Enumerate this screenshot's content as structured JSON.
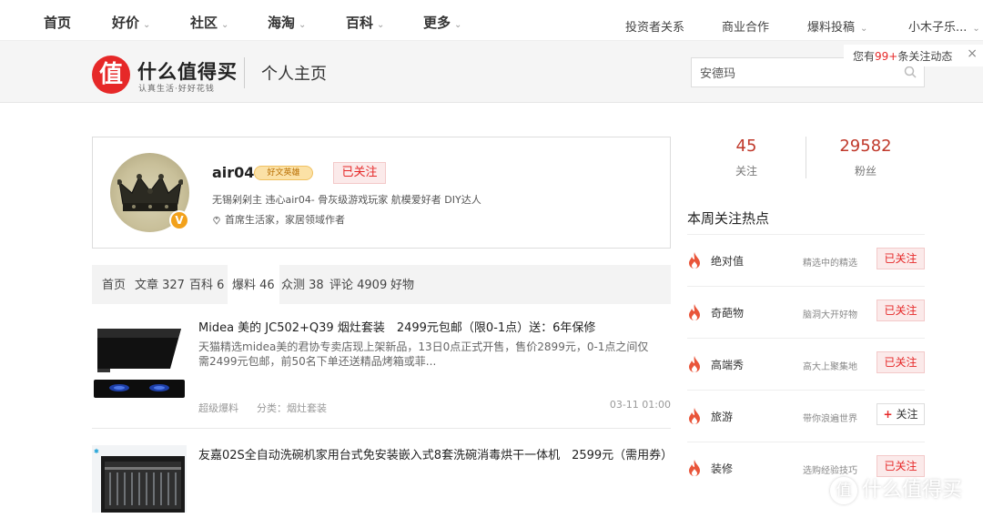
{
  "topnav": {
    "left": [
      {
        "label": "首页",
        "chevron": false
      },
      {
        "label": "好价",
        "chevron": true
      },
      {
        "label": "社区",
        "chevron": true
      },
      {
        "label": "海淘",
        "chevron": true
      },
      {
        "label": "百科",
        "chevron": true
      },
      {
        "label": "更多",
        "chevron": true
      }
    ],
    "right": [
      {
        "label": "投资者关系",
        "chevron": false
      },
      {
        "label": "商业合作",
        "chevron": false
      },
      {
        "label": "爆料投稿",
        "chevron": true
      },
      {
        "label": "小木子乐...",
        "chevron": true
      }
    ],
    "chevron_glyph": "⌄"
  },
  "header": {
    "logo_char": "值",
    "logo_text": "什么值得买",
    "logo_sub": "认真生活·好好花钱",
    "page_title": "个人主页",
    "search_value": "安德玛",
    "search_icon": "search-icon"
  },
  "notify": {
    "prefix": "您有",
    "count": "99+",
    "suffix": "条关注动态",
    "close": "×"
  },
  "profile": {
    "username": "air04",
    "medal": "好文英雄",
    "follow_state": "已关注",
    "bio": "无锡剁剁主 违心air04- 骨灰级游戏玩家 航模爱好者 DIY达人",
    "location_icon": "location-pin-icon",
    "title": "首席生活家，家居领域作者",
    "verified_badge": "V"
  },
  "tabs": [
    {
      "label": "首页",
      "active": false
    },
    {
      "label": "文章 327",
      "active": false
    },
    {
      "label": "百科 6",
      "active": false
    },
    {
      "label": "爆料 46",
      "active": true
    },
    {
      "label": "众测 38",
      "active": false
    },
    {
      "label": "评论 4909",
      "active": false
    },
    {
      "label": "好物",
      "active": false
    }
  ],
  "articles": [
    {
      "title": "Midea 美的 JC502+Q39 烟灶套装　2499元包邮（限0-1点）送：6年保修",
      "desc": "天猫精选midea美的君协专卖店现上架新品，13日0点正式开售，售价2899元，0-1点之间仅需2499元包邮，前50名下单还送精品烤箱或菲...",
      "tag": "超级爆料",
      "category": "分类：烟灶套装",
      "time": "03-11 01:00"
    },
    {
      "title": "友嘉02S全自动洗碗机家用台式免安装嵌入式8套洗碗消毒烘干一体机　2599元（需用券）"
    }
  ],
  "stats": [
    {
      "num": "45",
      "label": "关注"
    },
    {
      "num": "29582",
      "label": "粉丝"
    }
  ],
  "hot": {
    "title": "本周关注热点",
    "items": [
      {
        "name": "绝对值",
        "slogan": "精选中的精选",
        "btn": "已关注",
        "followed": true
      },
      {
        "name": "奇葩物",
        "slogan": "脑洞大开好物",
        "btn": "已关注",
        "followed": true
      },
      {
        "name": "高端秀",
        "slogan": "高大上聚集地",
        "btn": "已关注",
        "followed": true
      },
      {
        "name": "旅游",
        "slogan": "带你浪遍世界",
        "btn": "关注",
        "followed": false
      },
      {
        "name": "装修",
        "slogan": "选购经验技巧",
        "btn": "已关注",
        "followed": true
      }
    ]
  },
  "watermark": {
    "char": "值",
    "text": "什么值得买"
  },
  "colors": {
    "brand_red": "#e62828",
    "stat_red": "#c0392b",
    "bg_gray": "#f5f5f5"
  }
}
